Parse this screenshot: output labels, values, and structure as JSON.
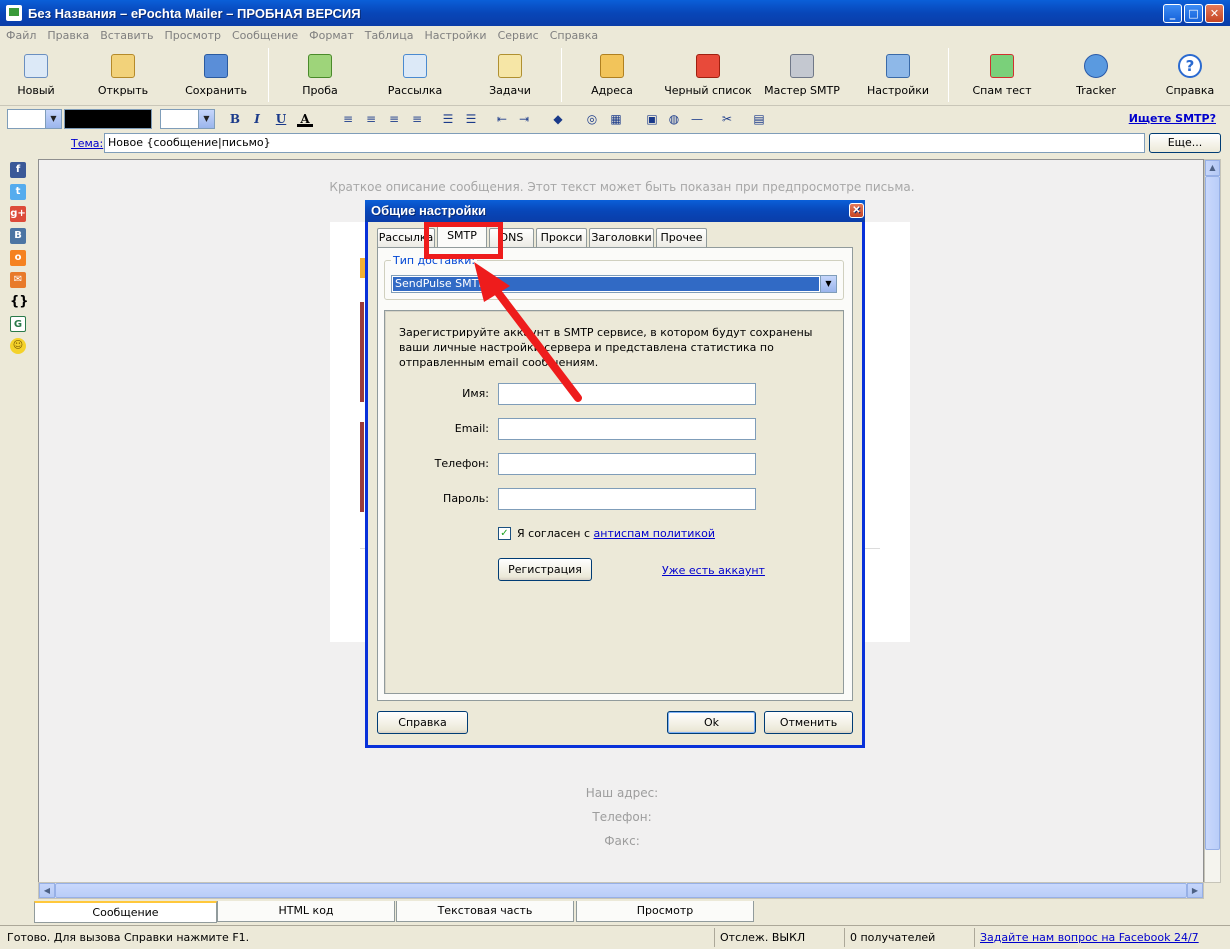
{
  "window": {
    "title": "Без Названия – ePochta Mailer – ПРОБНАЯ ВЕРСИЯ",
    "minimize": "_",
    "maximize": "□",
    "close": "✕"
  },
  "menu": [
    "Файл",
    "Правка",
    "Вставить",
    "Просмотр",
    "Сообщение",
    "Формат",
    "Таблица",
    "Настройки",
    "Сервис",
    "Справка"
  ],
  "toolbar": {
    "new": "Новый",
    "open": "Открыть",
    "save": "Сохранить",
    "test": "Проба",
    "mailing": "Рассылка",
    "tasks": "Задачи",
    "addresses": "Адреса",
    "blacklist": "Черный список",
    "smtp_wizard": "Мастер SMTP",
    "settings": "Настройки",
    "spam_test": "Спам тест",
    "tracker": "Tracker",
    "help": "Справка"
  },
  "formatbar": {
    "find_smtp": "Ищете SMTP?"
  },
  "subject": {
    "label": "Тема:",
    "value": "Новое {сообщение|письмо}",
    "more": "Еще..."
  },
  "editor": {
    "preheader": "Краткое описание сообщения. Этот текст может быть показан при предпросмотре письма.",
    "address": "Наш адрес:",
    "phone": "Телефон:",
    "fax": "Факс:"
  },
  "bottom_tabs": [
    "Сообщение",
    "HTML код",
    "Текстовая часть",
    "Просмотр"
  ],
  "status": {
    "ready": "Готово. Для вызова Справки нажмите F1.",
    "tracking": "Отслеж. ВЫКЛ",
    "recipients": "0 получателей",
    "facebook": "Задайте нам вопрос на Facebook 24/7"
  },
  "dialog": {
    "title": "Общие настройки",
    "tabs": [
      "Рассылка",
      "SMTP",
      "DNS",
      "Прокси",
      "Заголовки",
      "Прочее"
    ],
    "delivery_type_label": "Тип доставки:",
    "delivery_type_value": "SendPulse SMTP",
    "description": "Зарегистрируйте аккаунт в SMTP сервисе, в котором будут сохранены ваши личные настройки сервера и представлена статистика по отправленным email сообщениям.",
    "name_label": "Имя:",
    "email_label": "Email:",
    "phone_label": "Телефон:",
    "password_label": "Пароль:",
    "agree_text": "Я согласен с ",
    "agree_link": "антиспам политикой",
    "register_button": "Регистрация",
    "have_account_link": "Уже есть аккаунт",
    "help_button": "Справка",
    "ok_button": "Ok",
    "cancel_button": "Отменить"
  },
  "colors": {
    "accent_blue": "#0a5fd8",
    "annotation_red": "#ee1c1c",
    "selection": "#316ac5"
  }
}
